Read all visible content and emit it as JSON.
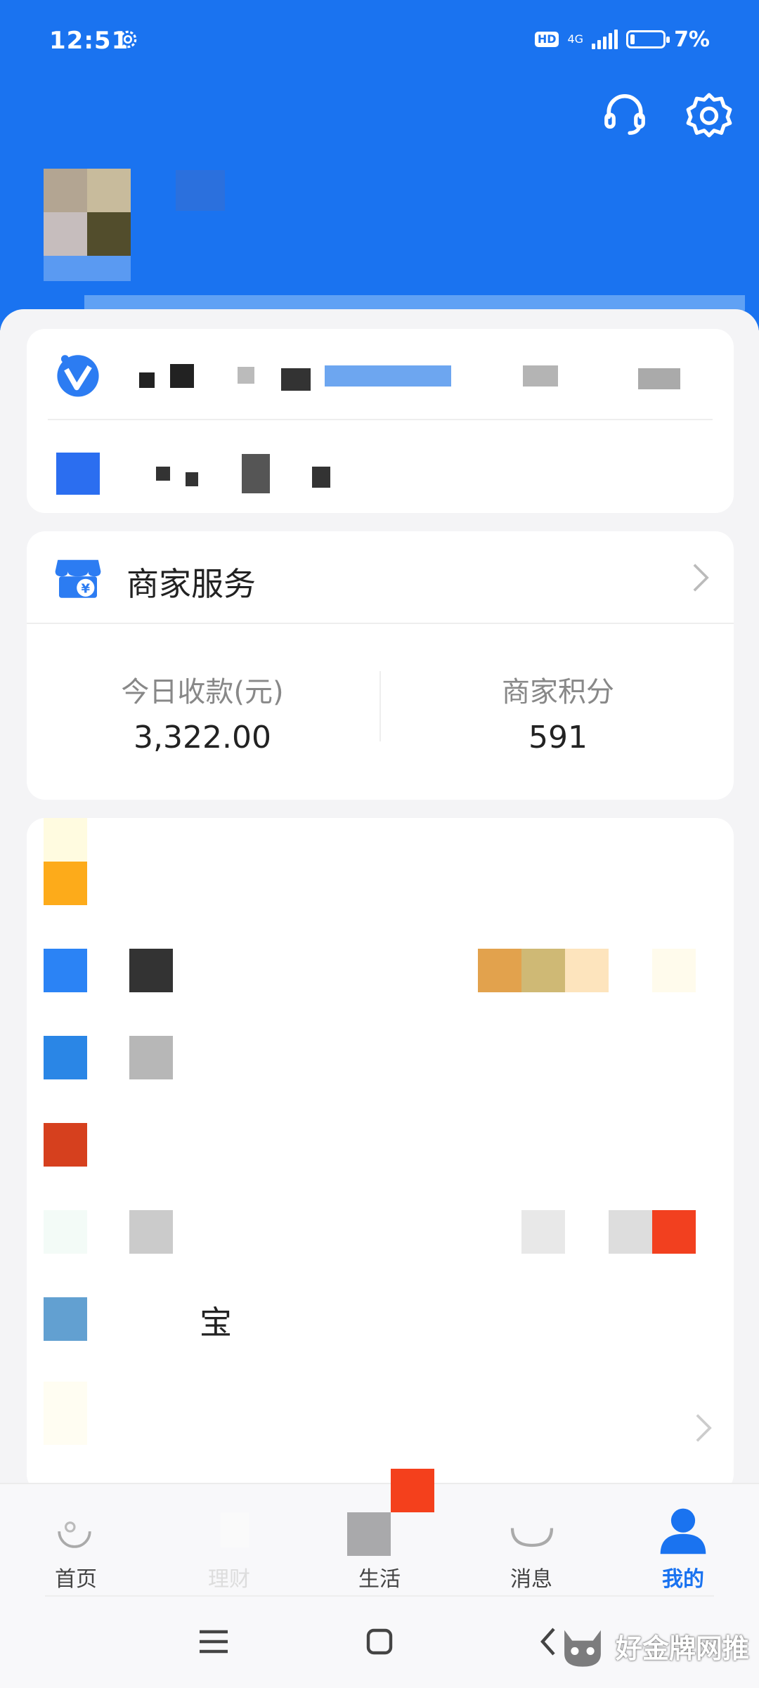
{
  "status_bar": {
    "time": "12:51",
    "hd": "HD",
    "network": "4G",
    "battery_percent": "7%"
  },
  "header": {
    "icons": [
      "headset-icon",
      "gear-icon"
    ]
  },
  "merchant_service": {
    "title": "商家服务",
    "stats": [
      {
        "label": "今日收款(元)",
        "value": "3,322.00"
      },
      {
        "label": "商家积分",
        "value": "591"
      }
    ]
  },
  "list": {
    "partial_label": "宝"
  },
  "bottom_nav": {
    "items": [
      {
        "label": "首页",
        "icon": "home-icon"
      },
      {
        "label": "理财",
        "icon": "wealth-icon"
      },
      {
        "label": "生活",
        "icon": "life-icon"
      },
      {
        "label": "消息",
        "icon": "message-icon"
      },
      {
        "label": "我的",
        "icon": "user-icon",
        "active": true
      }
    ],
    "active_color": "#1a73f0"
  },
  "system_nav": [
    "menu-icon",
    "home-square-icon",
    "back-icon"
  ],
  "watermark": "好金牌网推",
  "colors": {
    "header_blue": "#1a73f0",
    "card_bg": "#ffffff",
    "page_bg": "#f4f4f6"
  }
}
